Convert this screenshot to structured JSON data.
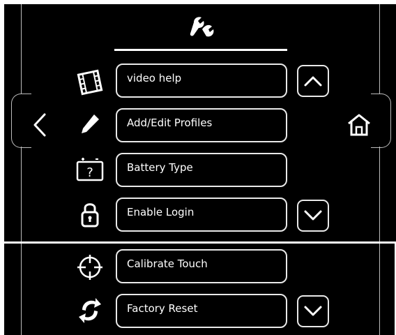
{
  "menu": {
    "items": [
      {
        "label": "video help",
        "icon": "film-icon"
      },
      {
        "label": "Add/Edit Profiles",
        "icon": "pencil-icon"
      },
      {
        "label": "Battery Type",
        "icon": "battery-question-icon"
      },
      {
        "label": "Enable Login",
        "icon": "lock-icon"
      },
      {
        "label": "Calibrate Touch",
        "icon": "crosshair-icon"
      },
      {
        "label": "Factory Reset",
        "icon": "reset-icon"
      }
    ]
  },
  "header": {
    "icon": "wrench-icon"
  },
  "nav": {
    "back_icon": "chevron-left-icon",
    "home_icon": "home-icon",
    "up_icon": "chevron-up-icon",
    "down_icon": "chevron-down-icon"
  }
}
